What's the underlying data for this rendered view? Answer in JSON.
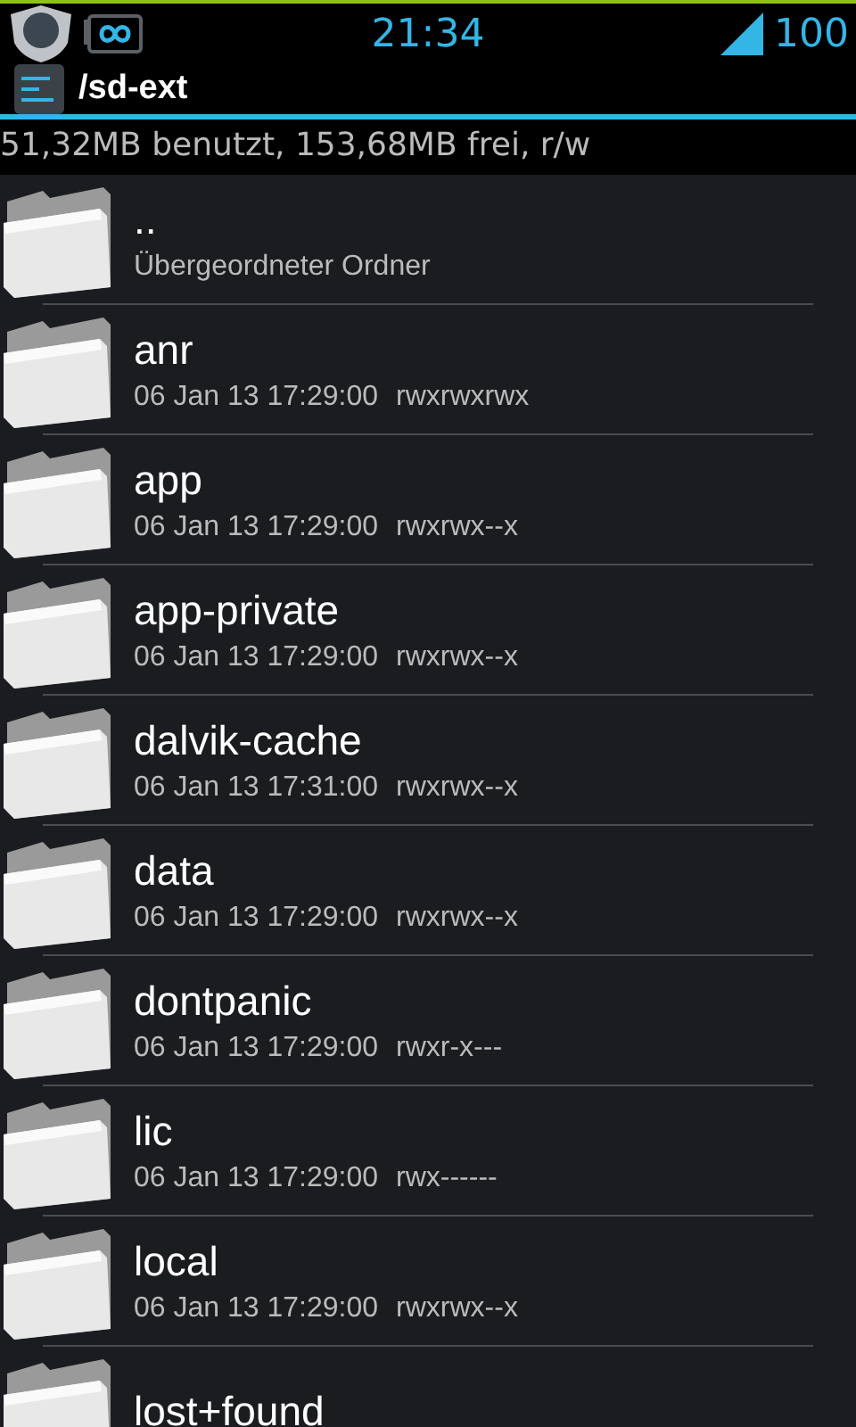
{
  "status_bar": {
    "time": "21:34",
    "battery": "100"
  },
  "title_bar": {
    "title": "/sd-ext"
  },
  "storage_info": "51,32MB benutzt, 153,68MB frei, r/w",
  "entries": [
    {
      "kind": "parent",
      "name": "..",
      "subtitle": "Übergeordneter Ordner"
    },
    {
      "kind": "folder",
      "name": "anr",
      "date": "06 Jan 13 17:29:00",
      "permissions": "rwxrwxrwx"
    },
    {
      "kind": "folder",
      "name": "app",
      "date": "06 Jan 13 17:29:00",
      "permissions": "rwxrwx--x"
    },
    {
      "kind": "folder",
      "name": "app-private",
      "date": "06 Jan 13 17:29:00",
      "permissions": "rwxrwx--x"
    },
    {
      "kind": "folder",
      "name": "dalvik-cache",
      "date": "06 Jan 13 17:31:00",
      "permissions": "rwxrwx--x"
    },
    {
      "kind": "folder",
      "name": "data",
      "date": "06 Jan 13 17:29:00",
      "permissions": "rwxrwx--x"
    },
    {
      "kind": "folder",
      "name": "dontpanic",
      "date": "06 Jan 13 17:29:00",
      "permissions": "rwxr-x---"
    },
    {
      "kind": "folder",
      "name": "lic",
      "date": "06 Jan 13 17:29:00",
      "permissions": "rwx------"
    },
    {
      "kind": "folder",
      "name": "local",
      "date": "06 Jan 13 17:29:00",
      "permissions": "rwxrwx--x"
    },
    {
      "kind": "folder",
      "name": "lost+found"
    }
  ]
}
